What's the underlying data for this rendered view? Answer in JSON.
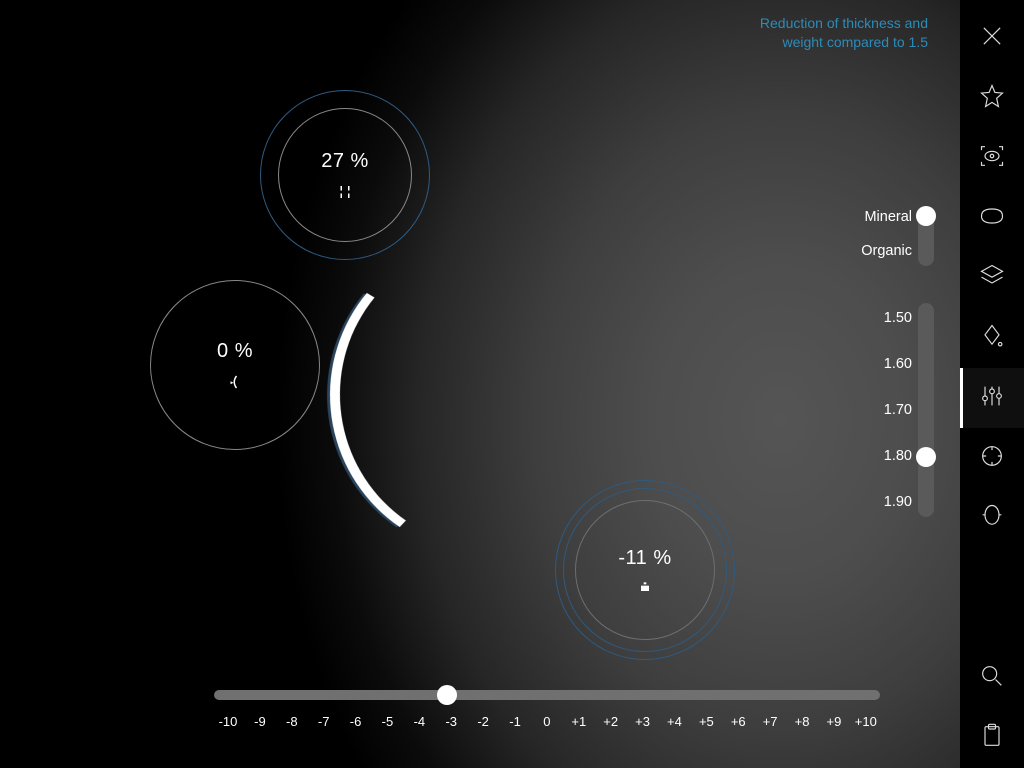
{
  "header": {
    "line1": "Reduction of thickness and",
    "line2": "weight compared to 1.5"
  },
  "rings": {
    "thickness": {
      "value": "27 %"
    },
    "curve": {
      "value": "0 %"
    },
    "weight": {
      "value": "-11 %"
    }
  },
  "material": {
    "options": [
      "Mineral",
      "Organic"
    ],
    "selected": "Mineral"
  },
  "index": {
    "options": [
      "1.50",
      "1.60",
      "1.70",
      "1.80",
      "1.90"
    ],
    "selected": "1.80"
  },
  "diopter": {
    "labels": [
      "-10",
      "-9",
      "-8",
      "-7",
      "-6",
      "-5",
      "-4",
      "-3",
      "-2",
      "-1",
      "0",
      "+1",
      "+2",
      "+3",
      "+4",
      "+5",
      "+6",
      "+7",
      "+8",
      "+9",
      "+10"
    ],
    "selected": "-3"
  },
  "sidebar": {
    "items": [
      {
        "name": "close-icon"
      },
      {
        "name": "star-icon"
      },
      {
        "name": "eye-scan-icon"
      },
      {
        "name": "lens-shape-icon"
      },
      {
        "name": "layers-icon"
      },
      {
        "name": "drop-icon"
      },
      {
        "name": "sliders-icon",
        "active": true
      },
      {
        "name": "target-icon"
      },
      {
        "name": "head-icon"
      }
    ],
    "footer": [
      {
        "name": "search-icon"
      },
      {
        "name": "clipboard-icon"
      }
    ]
  }
}
